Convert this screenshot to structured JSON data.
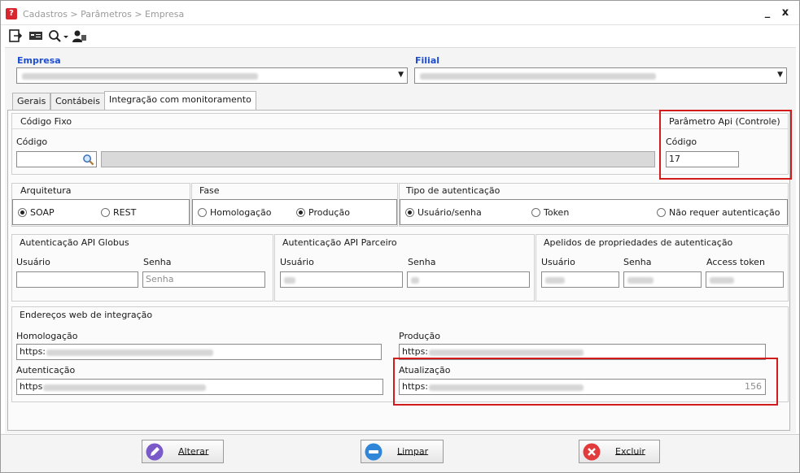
{
  "window": {
    "title": "Cadastros > Parâmetros > Empresa",
    "minimize": "_",
    "close": "x"
  },
  "toolbar": {
    "icons": [
      "exit-icon",
      "card-icon",
      "search-dropdown-icon",
      "user-icon"
    ]
  },
  "empresa": {
    "label": "Empresa",
    "value": ""
  },
  "filial": {
    "label": "Filial",
    "value": ""
  },
  "tabs": [
    {
      "label": "Gerais"
    },
    {
      "label": "Contábeis"
    },
    {
      "label": "Integração com monitoramento",
      "active": true
    }
  ],
  "codigo_fixo": {
    "title": "Código Fixo",
    "codigo_label": "Código"
  },
  "param_api": {
    "title": "Parâmetro Api (Controle)",
    "codigo_label": "Código",
    "codigo_value": "17"
  },
  "arquitetura": {
    "title": "Arquitetura",
    "options": [
      {
        "label": "SOAP",
        "selected": true
      },
      {
        "label": "REST",
        "selected": false
      }
    ]
  },
  "fase": {
    "title": "Fase",
    "options": [
      {
        "label": "Homologação",
        "selected": false
      },
      {
        "label": "Produção",
        "selected": true
      }
    ]
  },
  "tipo_aut": {
    "title": "Tipo de autenticação",
    "options": [
      {
        "label": "Usuário/senha",
        "selected": true
      },
      {
        "label": "Token",
        "selected": false
      },
      {
        "label": "Não requer autenticação",
        "selected": false
      }
    ]
  },
  "aut_globus": {
    "title": "Autenticação API Globus",
    "usuario_label": "Usuário",
    "senha_label": "Senha",
    "senha_placeholder": "Senha"
  },
  "aut_parceiro": {
    "title": "Autenticação API Parceiro",
    "usuario_label": "Usuário",
    "senha_label": "Senha"
  },
  "apelidos": {
    "title": "Apelidos de propriedades de autenticação",
    "usuario_label": "Usuário",
    "senha_label": "Senha",
    "token_label": "Access token"
  },
  "enderecos": {
    "title": "Endereços web de integração",
    "homologacao_label": "Homologação",
    "homologacao_prefix": "https:",
    "producao_label": "Produção",
    "producao_prefix": "https:",
    "autenticacao_label": "Autenticação",
    "autenticacao_prefix": "https",
    "atualizacao_label": "Atualização",
    "atualizacao_prefix": "https:",
    "atualizacao_count": "156"
  },
  "buttons": {
    "alterar": "Alterar",
    "limpar": "Limpar",
    "excluir": "Excluir"
  },
  "colors": {
    "accent_label": "#1f4fd0",
    "highlight": "#d21c1c"
  }
}
